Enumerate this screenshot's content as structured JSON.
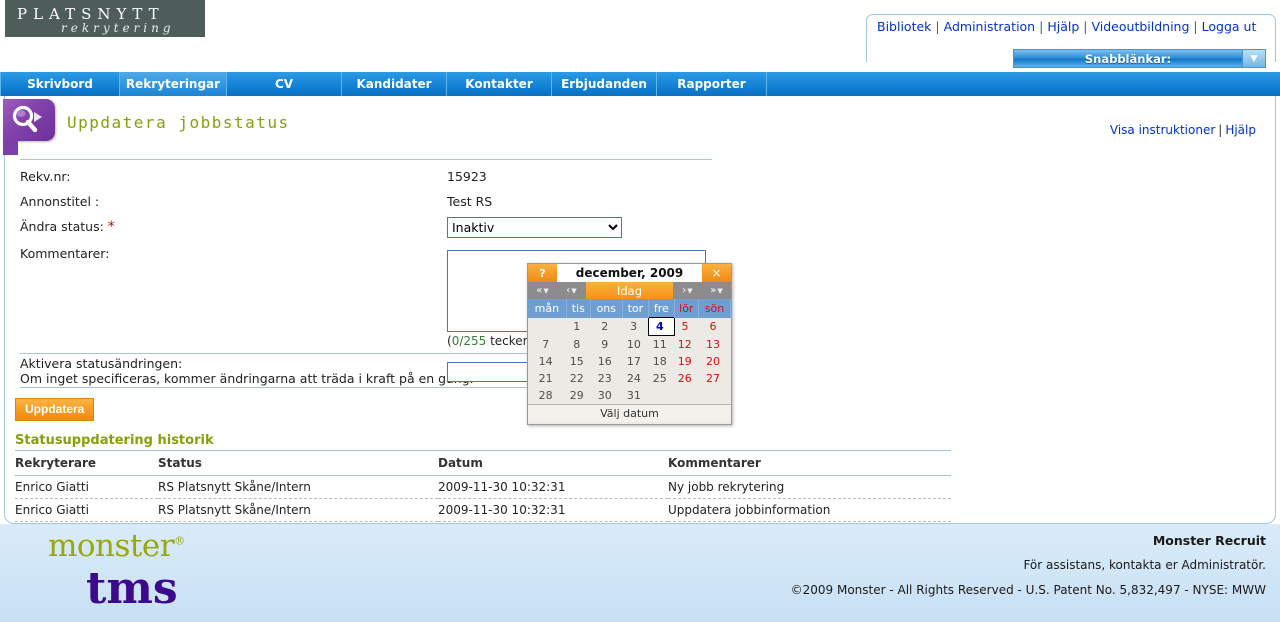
{
  "brand": {
    "logo_main": "PLATSNYTT",
    "logo_sub": "rekrytering"
  },
  "top_links": {
    "items": [
      "Bibliotek",
      "Administration",
      "Hjälp",
      "Videoutbildning",
      "Logga ut"
    ],
    "separator": "|"
  },
  "quicklinks": {
    "label": "Snabblänkar:",
    "arrow": "▼"
  },
  "nav": {
    "tabs": [
      {
        "label": "Skrivbord",
        "active": false
      },
      {
        "label": "Rekryteringar",
        "active": true
      },
      {
        "label": "CV",
        "active": false
      },
      {
        "label": "Kandidater",
        "active": false
      },
      {
        "label": "Kontakter",
        "active": false
      },
      {
        "label": "Erbjudanden",
        "active": false
      },
      {
        "label": "Rapporter",
        "active": false
      }
    ]
  },
  "page": {
    "title": "Uppdatera jobbstatus",
    "action_instructions": "Visa instruktioner",
    "action_help": "Hjälp",
    "action_separator": "|"
  },
  "form": {
    "rekv_label": "Rekv.nr:",
    "rekv_value": "15923",
    "annonstitel_label": "Annonstitel :",
    "annonstitel_value": "Test RS",
    "status_label": "Ändra status:",
    "status_required": "*",
    "status_value": "Inaktiv",
    "status_options": [
      "Inaktiv"
    ],
    "kommentarer_label": "Kommentarer:",
    "kommentarer_value": "",
    "charcount": "(0/255 tecken",
    "charcount_num": "0/255",
    "activate_label_line1": "Aktivera statusändringen:",
    "activate_label_line2": "Om inget specificeras, kommer ändringarna att träda i kraft på en gång.",
    "date_value": "",
    "update_button": "Uppdatera"
  },
  "calendar": {
    "help": "?",
    "close": "×",
    "title": "december, 2009",
    "nav_prev_year": "«",
    "nav_prev_month": "‹",
    "today": "Idag",
    "nav_next_month": "›",
    "nav_next_year": "»",
    "weekdays": [
      "mån",
      "tis",
      "ons",
      "tor",
      "fre",
      "lör",
      "sön"
    ],
    "weekend_index": [
      5,
      6
    ],
    "weeks": [
      [
        "",
        "1",
        "2",
        "3",
        "4",
        "5",
        "6"
      ],
      [
        "7",
        "8",
        "9",
        "10",
        "11",
        "12",
        "13"
      ],
      [
        "14",
        "15",
        "16",
        "17",
        "18",
        "19",
        "20"
      ],
      [
        "21",
        "22",
        "23",
        "24",
        "25",
        "26",
        "27"
      ],
      [
        "28",
        "29",
        "30",
        "31",
        "",
        "",
        ""
      ]
    ],
    "selected_day": "4",
    "footer": "Välj datum"
  },
  "history": {
    "title": "Statusuppdatering historik",
    "columns": [
      "Rekryterare",
      "Status",
      "Datum",
      "Kommentarer"
    ],
    "rows": [
      [
        "Enrico Giatti",
        "RS Platsnytt Skåne/Intern",
        "2009-11-30 10:32:31",
        "Ny jobb rekrytering"
      ],
      [
        "Enrico Giatti",
        "RS Platsnytt Skåne/Intern",
        "2009-11-30 10:32:31",
        "Uppdatera jobbinformation"
      ]
    ]
  },
  "footer": {
    "monster": "monster",
    "monster_reg": "®",
    "tms": "tms",
    "brand": "Monster Recruit",
    "assist": "För assistans, kontakta er Administratör.",
    "copyright": "©2009 Monster - All Rights Reserved - U.S. Patent No. 5,832,497 - NYSE: MWW"
  },
  "colors": {
    "nav_blue": "#1585d8",
    "accent_orange": "#f79a1e",
    "title_olive": "#86a009",
    "link_blue": "#0033cc",
    "required_red": "#d00000",
    "weekend_red": "#d01010",
    "purple": "#7e3ea9"
  }
}
